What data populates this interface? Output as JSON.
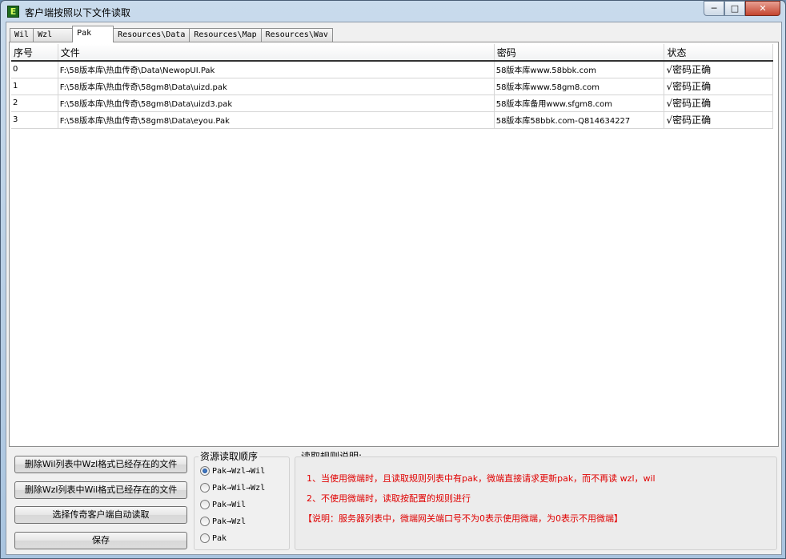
{
  "window": {
    "title": "客户端按照以下文件读取",
    "app_icon": "E",
    "minimize_glyph": "─",
    "maximize_glyph": "□",
    "close_glyph": "✕"
  },
  "tabs": [
    {
      "label": "Wil",
      "active": false
    },
    {
      "label": "Wzl",
      "active": false
    },
    {
      "label": "Pak",
      "active": true
    },
    {
      "label": "Resources\\Data",
      "active": false
    },
    {
      "label": "Resources\\Map",
      "active": false
    },
    {
      "label": "Resources\\Wav",
      "active": false
    }
  ],
  "table": {
    "columns": [
      "序号",
      "文件",
      "密码",
      "状态"
    ],
    "rows": [
      {
        "index": "0",
        "file": "F:\\58版本库\\热血传奇\\Data\\NewopUI.Pak",
        "password": "58版本库www.58bbk.com",
        "status": "√密码正确"
      },
      {
        "index": "1",
        "file": "F:\\58版本库\\热血传奇\\58gm8\\Data\\uizd.pak",
        "password": "58版本库www.58gm8.com",
        "status": "√密码正确"
      },
      {
        "index": "2",
        "file": "F:\\58版本库\\热血传奇\\58gm8\\Data\\uizd3.pak",
        "password": "58版本库备用www.sfgm8.com",
        "status": "√密码正确"
      },
      {
        "index": "3",
        "file": "F:\\58版本库\\热血传奇\\58gm8\\Data\\eyou.Pak",
        "password": "58版本库58bbk.com-Q814634227",
        "status": "√密码正确"
      }
    ]
  },
  "buttons": {
    "delete_wil": "删除Wil列表中Wzl格式已经存在的文件",
    "delete_wzl": "删除Wzl列表中Wil格式已经存在的文件",
    "select_client": "选择传奇客户端自动读取",
    "save": "保存"
  },
  "read_order": {
    "title": "资源读取顺序",
    "options": [
      {
        "label": "Pak→Wzl→Wil",
        "selected": true
      },
      {
        "label": "Pak→Wil→Wzl",
        "selected": false
      },
      {
        "label": "Pak→Wil",
        "selected": false
      },
      {
        "label": "Pak→Wzl",
        "selected": false
      },
      {
        "label": "Pak",
        "selected": false
      }
    ]
  },
  "rules": {
    "title": "读取规则说明:",
    "lines": [
      "1、当使用微端时，且读取规则列表中有pak，微端直接请求更新pak，而不再读 wzl，wil",
      "2、不使用微端时，读取按配置的规则进行",
      "【说明：服务器列表中，微端网关端口号不为0表示使用微端，为0表示不用微端】"
    ],
    "color": "#e00000"
  }
}
